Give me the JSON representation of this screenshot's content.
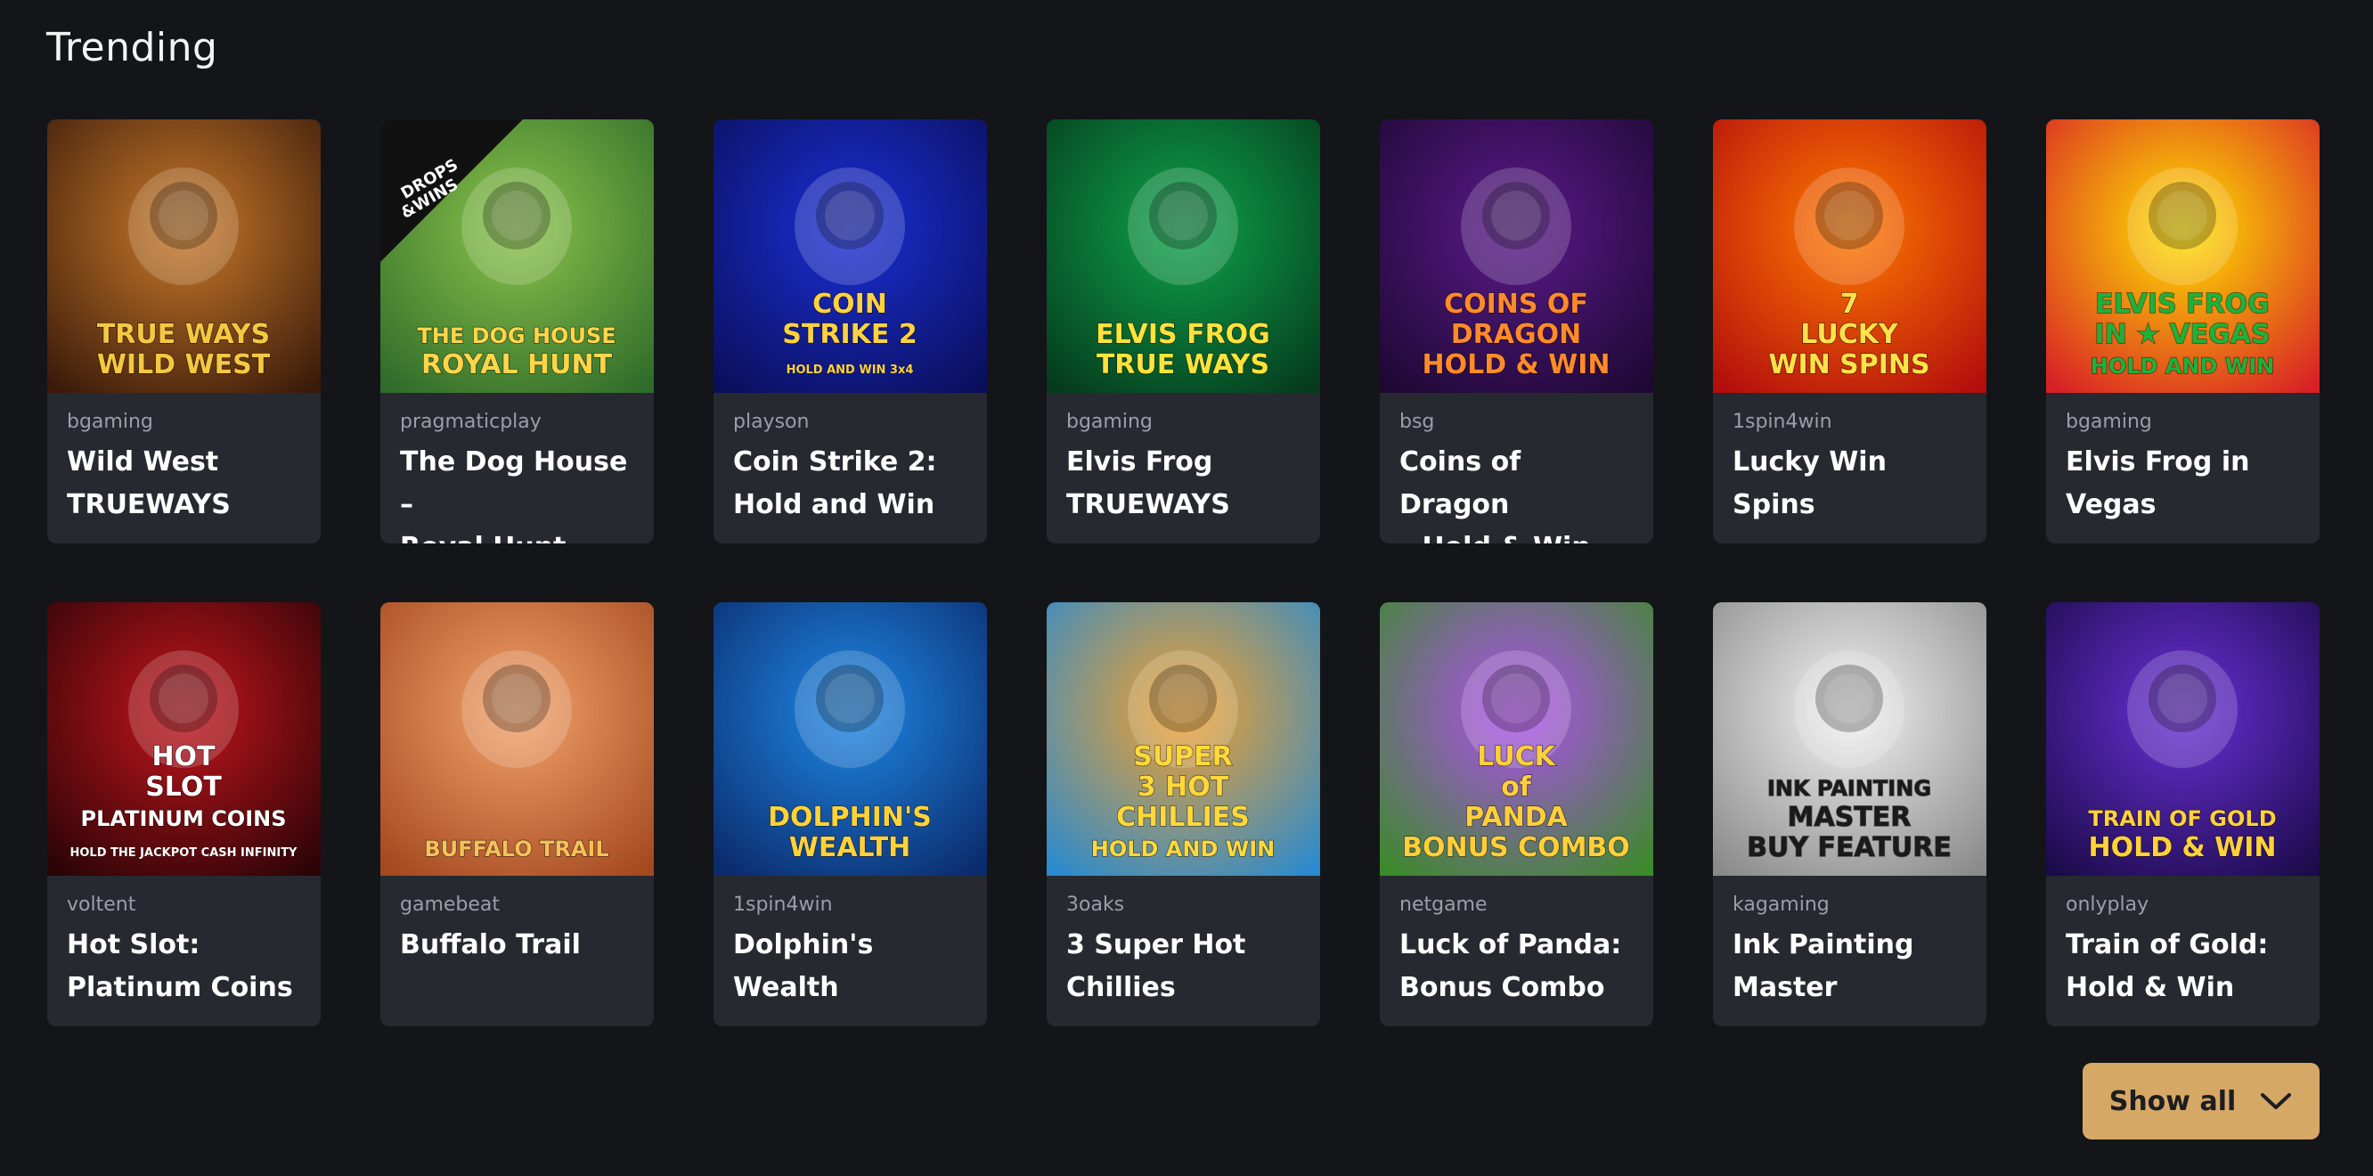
{
  "section": {
    "title": "Trending"
  },
  "games": [
    {
      "provider": "bgaming",
      "title_lines": [
        "Wild West",
        "TRUEWAYS"
      ],
      "art": {
        "bg1": "#c97a2a",
        "bg2": "#3a1a0a",
        "text": [
          "TRUE WAYS",
          "WILD WEST"
        ],
        "text_color": "#f5c842",
        "icon": "cowgirl-icon"
      }
    },
    {
      "provider": "pragmaticplay",
      "title_lines": [
        "The Dog House –",
        "Royal Hunt"
      ],
      "art": {
        "bg1": "#8bc34a",
        "bg2": "#2f6b2a",
        "text": [
          "THE DOG HOUSE",
          "ROYAL HUNT"
        ],
        "text_color": "#ffd54a",
        "badge": [
          "DROPS",
          "&WINS"
        ],
        "icon": "dog-icon"
      }
    },
    {
      "provider": "playson",
      "title_lines": [
        "Coin Strike 2:",
        "Hold and Win"
      ],
      "art": {
        "bg1": "#1b2fd6",
        "bg2": "#0a0f5a",
        "text": [
          "COIN",
          "STRIKE 2",
          "HOLD AND WIN 3x4"
        ],
        "text_color": "#ffd23f",
        "icon": "coin-icon"
      }
    },
    {
      "provider": "bgaming",
      "title_lines": [
        "Elvis Frog",
        "TRUEWAYS"
      ],
      "art": {
        "bg1": "#0ea34a",
        "bg2": "#053a1c",
        "text": [
          "ELVIS FROG",
          "TRUE WAYS"
        ],
        "text_color": "#ffe23a",
        "icon": "frog-icon"
      }
    },
    {
      "provider": "bsg",
      "title_lines": [
        "Coins of Dragon",
        "– Hold & Win"
      ],
      "art": {
        "bg1": "#5a1a8a",
        "bg2": "#1e0833",
        "text": [
          "COINS OF",
          "DRAGON",
          "HOLD & WIN"
        ],
        "text_color": "#ff8a2a",
        "icon": "dragon-icon"
      }
    },
    {
      "provider": "1spin4win",
      "title_lines": [
        "Lucky Win Spins"
      ],
      "art": {
        "bg1": "#ff7a00",
        "bg2": "#b20d0d",
        "text": [
          "7",
          "LUCKY",
          "WIN SPINS"
        ],
        "text_color": "#ffe14a",
        "icon": "seven-icon"
      }
    },
    {
      "provider": "bgaming",
      "title_lines": [
        "Elvis Frog in",
        "Vegas"
      ],
      "art": {
        "bg1": "#ffe400",
        "bg2": "#d81f26",
        "text": [
          "ELVIS FROG",
          "IN ★ VEGAS",
          "HOLD AND WIN"
        ],
        "text_color": "#1fb03c",
        "icon": "frog-icon"
      }
    },
    {
      "provider": "voltent",
      "title_lines": [
        "Hot Slot:",
        "Platinum Coins"
      ],
      "art": {
        "bg1": "#c2151c",
        "bg2": "#2a0407",
        "text": [
          "HOT",
          "SLOT",
          "PLATINUM COINS",
          "HOLD THE JACKPOT CASH INFINITY"
        ],
        "text_color": "#ffffff",
        "icon": "hot-slot-icon"
      }
    },
    {
      "provider": "gamebeat",
      "title_lines": [
        "Buffalo Trail"
      ],
      "art": {
        "bg1": "#f2a36b",
        "bg2": "#a4481f",
        "text": [
          "BUFFALO TRAIL"
        ],
        "text_color": "#f4c25a",
        "icon": "buffalo-icon"
      }
    },
    {
      "provider": "1spin4win",
      "title_lines": [
        "Dolphin's Wealth"
      ],
      "art": {
        "bg1": "#1e88e5",
        "bg2": "#0b2a6b",
        "text": [
          "DOLPHIN'S",
          "WEALTH"
        ],
        "text_color": "#ffd23a",
        "icon": "dolphin-icon"
      }
    },
    {
      "provider": "3oaks",
      "title_lines": [
        "3 Super Hot",
        "Chillies"
      ],
      "art": {
        "bg1": "#f3a12d",
        "bg2": "#2a8acf",
        "text": [
          "SUPER",
          "3 HOT",
          "CHILLIES",
          "HOLD AND WIN"
        ],
        "text_color": "#ffd83a",
        "icon": "mariachi-icon"
      }
    },
    {
      "provider": "netgame",
      "title_lines": [
        "Luck of Panda:",
        "Bonus Combo"
      ],
      "art": {
        "bg1": "#b04ef0",
        "bg2": "#3c8a2a",
        "text": [
          "LUCK",
          "of",
          "PANDA",
          "BONUS COMBO"
        ],
        "text_color": "#ffcf3a",
        "icon": "panda-icon"
      }
    },
    {
      "provider": "kagaming",
      "title_lines": [
        "Ink Painting",
        "Master"
      ],
      "art": {
        "bg1": "#f2f2f2",
        "bg2": "#8a8a8a",
        "text": [
          "INK PAINTING",
          "MASTER",
          "BUY FEATURE"
        ],
        "text_color": "#1a1a1a",
        "icon": "ink-flower-icon"
      }
    },
    {
      "provider": "onlyplay",
      "title_lines": [
        "Train of Gold:",
        "Hold & Win"
      ],
      "art": {
        "bg1": "#6a2fd6",
        "bg2": "#1b0b4a",
        "text": [
          "TRAIN OF GOLD",
          "HOLD & WIN"
        ],
        "text_color": "#ffd23a",
        "icon": "train-icon"
      }
    }
  ],
  "show_all": {
    "label": "Show all",
    "icon": "chevron-down-icon"
  },
  "colors": {
    "page_bg": "#131519",
    "card_bg": "#262a30",
    "provider_text": "#9a9ea6",
    "button_bg": "#d6a866",
    "button_text": "#1b1d21"
  }
}
